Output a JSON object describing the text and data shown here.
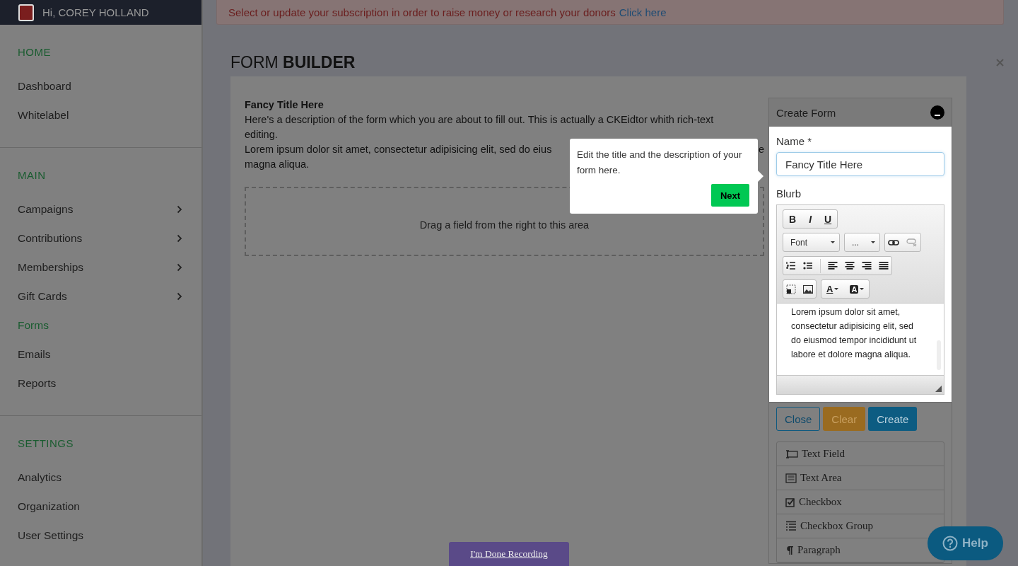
{
  "header": {
    "greeting": "Hi, COREY HOLLAND"
  },
  "sidebar": {
    "sections": [
      {
        "title": "HOME",
        "items": [
          {
            "label": "Dashboard",
            "selected": false,
            "has_submenu": false
          },
          {
            "label": "Whitelabel",
            "selected": false,
            "has_submenu": false
          }
        ]
      },
      {
        "title": "MAIN",
        "items": [
          {
            "label": "Campaigns",
            "selected": false,
            "has_submenu": true
          },
          {
            "label": "Contributions",
            "selected": false,
            "has_submenu": true
          },
          {
            "label": "Memberships",
            "selected": false,
            "has_submenu": true
          },
          {
            "label": "Gift Cards",
            "selected": false,
            "has_submenu": true
          },
          {
            "label": "Forms",
            "selected": true,
            "has_submenu": false
          },
          {
            "label": "Emails",
            "selected": false,
            "has_submenu": false
          },
          {
            "label": "Reports",
            "selected": false,
            "has_submenu": false
          }
        ]
      },
      {
        "title": "SETTINGS",
        "items": [
          {
            "label": "Analytics",
            "selected": false,
            "has_submenu": false
          },
          {
            "label": "Organization",
            "selected": false,
            "has_submenu": false
          },
          {
            "label": "User Settings",
            "selected": false,
            "has_submenu": false
          }
        ]
      }
    ]
  },
  "banner": {
    "text": "Select or update your subscription in order to raise money or research your donors",
    "link": "Click here"
  },
  "page_title": "FORM **BUILDER**",
  "form_preview": {
    "title": "Fancy Title Here",
    "description": "Here's a description of the form which you are about to fill out. This is actually a CKEidtor whith rich-text editing.",
    "lorem_start": "Lorem ipsum dolor sit amet, consectetur adipisicing elit, sed do eius",
    "lorem_end": "e",
    "lorem_line2": "magna aliqua.",
    "drop_hint": "Drag a field from the right to this area"
  },
  "tooltip": {
    "text": "Edit the title and the description of your form here.",
    "button": "Next"
  },
  "create_form": {
    "title": "Create Form",
    "name_label": "Name *",
    "name_value": "Fancy Title Here",
    "blurb_label": "Blurb",
    "toolbar": {
      "bold": "B",
      "italic": "I",
      "underline": "U",
      "font": "Font",
      "size": "...",
      "text_color": "A",
      "bg_color": "A"
    },
    "blurb_text": "Lorem ipsum dolor sit amet, consectetur adipisicing elit, sed do eiusmod tempor incididunt ut labore et dolore magna aliqua.",
    "buttons": [
      {
        "label": "Close",
        "kind": "outline"
      },
      {
        "label": "Clear",
        "kind": "warning"
      },
      {
        "label": "Create",
        "kind": "primary"
      }
    ],
    "field_types": [
      {
        "label": "Text Field",
        "kind": "text_field"
      },
      {
        "label": "Text Area",
        "kind": "text_area"
      },
      {
        "label": "Checkbox",
        "kind": "checkbox"
      },
      {
        "label": "Checkbox Group",
        "kind": "checkbox_group"
      },
      {
        "label": "Paragraph",
        "kind": "paragraph"
      }
    ]
  },
  "recording": {
    "label": "I'm Done Recording"
  },
  "help": {
    "label": "Help"
  }
}
